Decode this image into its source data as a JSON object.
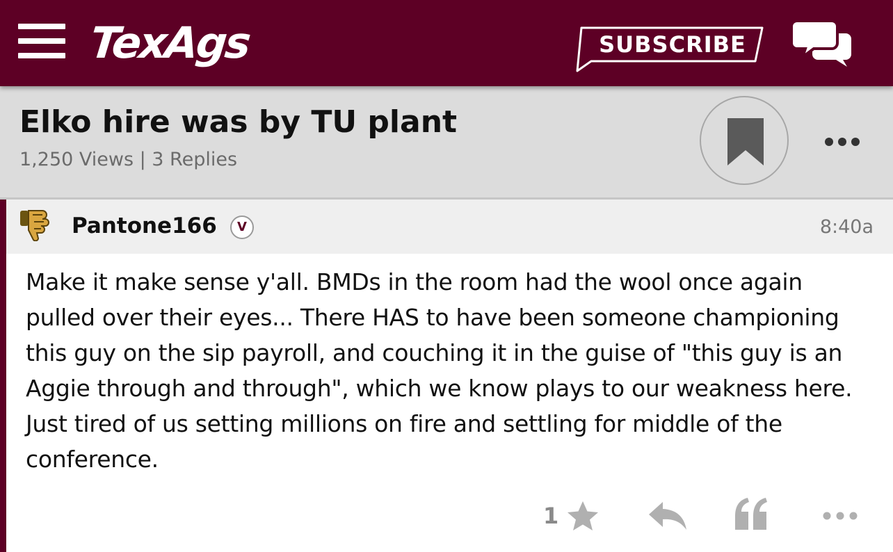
{
  "header": {
    "logo": "TexAgs",
    "subscribe_label": "SUBSCRIBE",
    "brand_color": "#5d0025"
  },
  "thread": {
    "title": "Elko hire was by TU plant",
    "meta": "1,250 Views | 3 Replies"
  },
  "post": {
    "username": "Pantone166",
    "badge": "V",
    "time": "8:40a",
    "body": "Make it make sense y'all. BMDs in the room had the wool once again pulled over their eyes... There HAS to have been someone championing this guy on the sip payroll, and couching it in the guise of \"this guy is an Aggie through and through\", which we know plays to our weakness here. Just tired of us setting millions on fire and settling for middle of the conference.",
    "star_count": "1"
  },
  "icons": {
    "menu": "hamburger-menu-icon",
    "chat": "chat-bubbles-icon",
    "bookmark": "bookmark-icon",
    "more": "ellipsis-icon",
    "star": "star-icon",
    "reply": "reply-arrow-icon",
    "quote": "quote-icon",
    "avatar": "thumbs-down-hand-icon"
  }
}
